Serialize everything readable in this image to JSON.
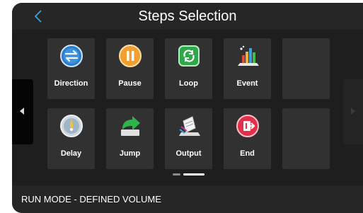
{
  "header": {
    "title": "Steps Selection",
    "back_icon": "back-chevron-icon"
  },
  "colors": {
    "accent": "#3aa8e6",
    "background": "#1e1e1e",
    "tile": "#313131"
  },
  "tiles": [
    {
      "label": "Direction",
      "icon": "direction-icon"
    },
    {
      "label": "Pause",
      "icon": "pause-icon"
    },
    {
      "label": "Loop",
      "icon": "loop-icon"
    },
    {
      "label": "Event",
      "icon": "event-icon"
    },
    {
      "label": "",
      "icon": ""
    },
    {
      "label": "Delay",
      "icon": "delay-icon"
    },
    {
      "label": "Jump",
      "icon": "jump-icon"
    },
    {
      "label": "Output",
      "icon": "output-icon"
    },
    {
      "label": "End",
      "icon": "end-icon"
    },
    {
      "label": "",
      "icon": ""
    }
  ],
  "pager": {
    "current_page": 2,
    "total_pages": 2
  },
  "footer": {
    "status": "RUN MODE - DEFINED VOLUME"
  }
}
